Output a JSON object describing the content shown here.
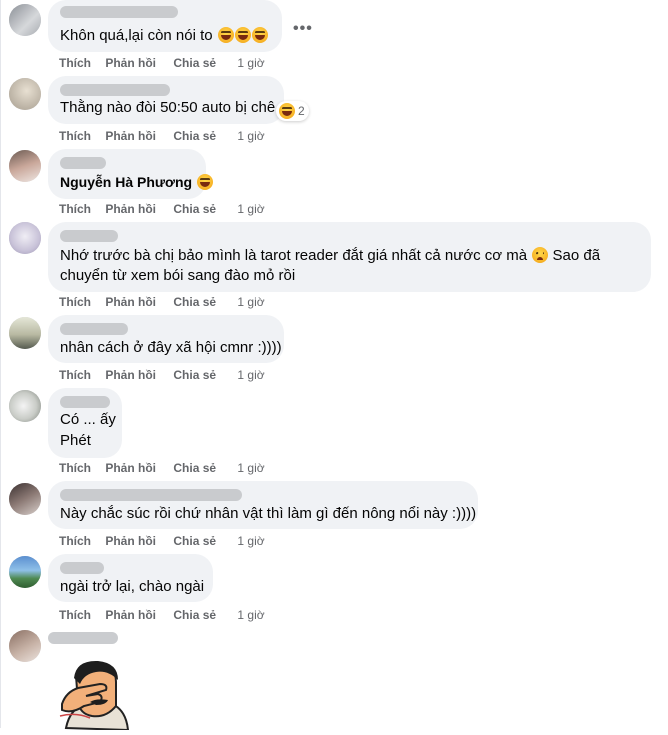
{
  "actions": {
    "like": "Thích",
    "reply": "Phản hồi",
    "share": "Chia sẻ"
  },
  "comments": [
    {
      "text": "Khôn quá,lại còn nói to",
      "time": "1 giờ"
    },
    {
      "text": "Thằng nào đòi 50:50 auto bị chê",
      "reaction_count": "2",
      "time": "1 giờ"
    },
    {
      "text": "Nguyễn Hà Phương",
      "time": "1 giờ"
    },
    {
      "text_line1": "Nhớ trước bà chị bảo mình là tarot reader đắt giá nhất cả nước cơ mà",
      "text_line1b": "Sao đã",
      "text_line2": "chuyển từ xem bói sang đào mỏ rồi",
      "time": "1 giờ"
    },
    {
      "text": "nhân cách ở đây xã hội cmnr :))))",
      "time": "1 giờ"
    },
    {
      "text_line1": "Có ... ấy",
      "text_line2": "Phét",
      "time": "1 giờ"
    },
    {
      "text": "Này chắc súc rồi chứ nhân vật thì làm gì đến nông nổi này :))))",
      "time": "1 giờ"
    },
    {
      "text": "ngài trở lại, chào ngài",
      "time": "1 giờ"
    }
  ],
  "more_icon": "more-horizontal-icon"
}
